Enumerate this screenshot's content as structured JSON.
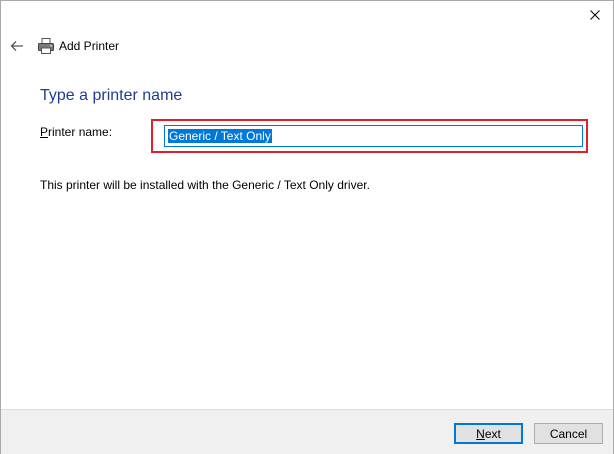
{
  "window": {
    "title": "Add Printer",
    "close_glyph": "✕",
    "back_glyph": "←"
  },
  "page": {
    "heading": "Type a printer name",
    "printer_name_label_mnemonic": "P",
    "printer_name_label_rest": "rinter name:",
    "printer_name_value": "Generic / Text Only",
    "info_text": "This printer will be installed with the Generic / Text Only driver."
  },
  "buttons": {
    "next_mnemonic": "N",
    "next_rest": "ext",
    "cancel": "Cancel"
  },
  "colors": {
    "heading": "#1e3c96",
    "highlight": "#e0202a",
    "selection": "#0078d7"
  },
  "icons": {
    "close": "close-icon",
    "back": "back-arrow-icon",
    "printer": "printer-icon"
  }
}
